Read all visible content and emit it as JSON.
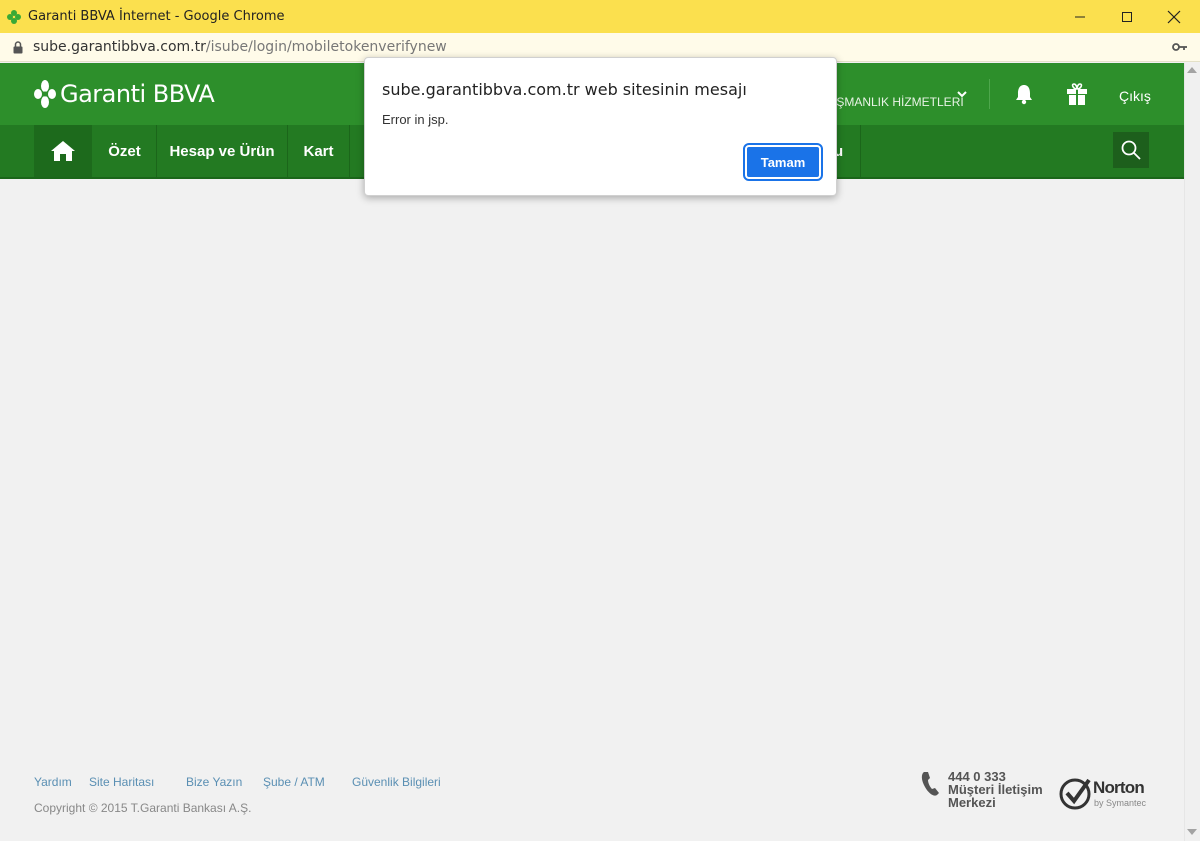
{
  "window": {
    "title": "Garanti BBVA İnternet - Google Chrome",
    "controls": [
      "minimize-icon",
      "maximize-icon",
      "close-icon"
    ]
  },
  "address_bar": {
    "host": "sube.garantibbva.com.tr",
    "path": "/isube/login/mobiletokenverifynew"
  },
  "header": {
    "logo_text": "Garanti BBVA",
    "advisory_menu": "IŞMANLIK HİZMETLERİ",
    "logout": "Çıkış",
    "icons": [
      "bell-icon",
      "gift-icon",
      "chevron-down-icon"
    ]
  },
  "nav": {
    "items": [
      "Özet",
      "Hesap ve Ürün",
      "Kart"
    ],
    "partial_item": "u",
    "icons": [
      "home-icon",
      "search-icon"
    ]
  },
  "dialog": {
    "title": "sube.garantibbva.com.tr web sitesinin mesajı",
    "message": "Error in jsp.",
    "ok_label": "Tamam"
  },
  "footer": {
    "links": [
      "Yardım",
      "Site Haritası",
      "Bize Yazın",
      "Şube / ATM",
      "Güvenlik Bilgileri"
    ],
    "copyright": "Copyright © 2015 T.Garanti Bankası A.Ş.",
    "call_number": "444 0 333",
    "call_line1": "Müşteri İletişim",
    "call_line2": "Merkezi",
    "norton": "Norton",
    "norton_sub": "by Symantec"
  },
  "colors": {
    "title_bar": "#fbe04e",
    "brand_green": "#2d8f2b",
    "nav_green": "#237a22",
    "button_blue": "#1a73e8"
  }
}
